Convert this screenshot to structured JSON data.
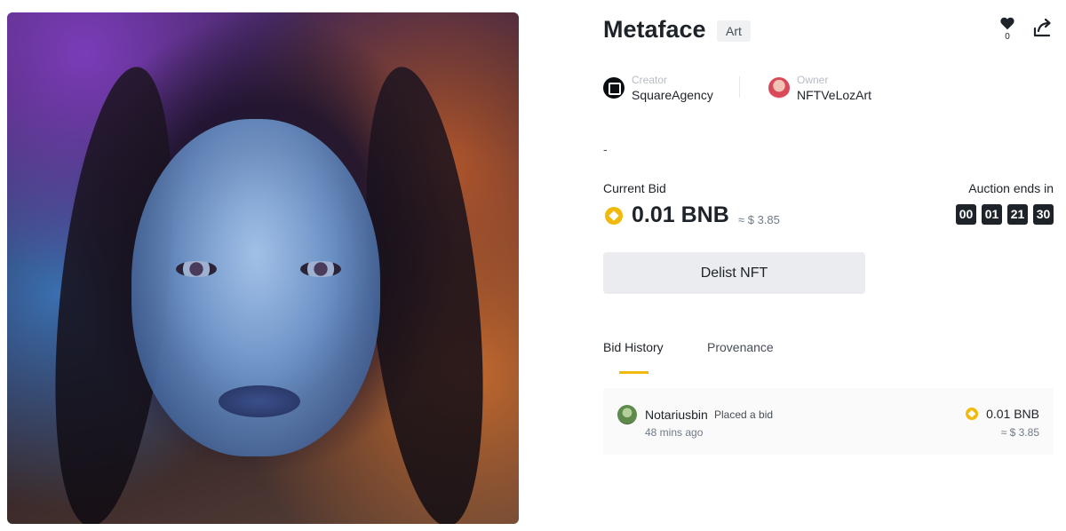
{
  "nft": {
    "title": "Metaface",
    "category": "Art",
    "likes": "0",
    "description": "-"
  },
  "creator": {
    "role_label": "Creator",
    "name": "SquareAgency"
  },
  "owner": {
    "role_label": "Owner",
    "name": "NFTVeLozArt"
  },
  "current_bid": {
    "label": "Current Bid",
    "amount": "0.01 BNB",
    "usd": "≈ $ 3.85"
  },
  "auction": {
    "label": "Auction ends in",
    "countdown": [
      "00",
      "01",
      "21",
      "30"
    ]
  },
  "actions": {
    "delist_label": "Delist NFT"
  },
  "tabs": [
    {
      "label": "Bid History",
      "active": true
    },
    {
      "label": "Provenance",
      "active": false
    }
  ],
  "bid_history": [
    {
      "bidder": "Notariusbin",
      "action": "Placed a bid",
      "time": "48 mins ago",
      "amount": "0.01 BNB",
      "usd": "≈ $ 3.85"
    }
  ],
  "colors": {
    "accent": "#f0b90b",
    "text_primary": "#1e2329",
    "button_bg": "#eaecef",
    "countdown_bg": "#1e2329"
  },
  "icons": {
    "like": "heart-icon",
    "share": "share-icon",
    "currency": "bnb-icon"
  }
}
